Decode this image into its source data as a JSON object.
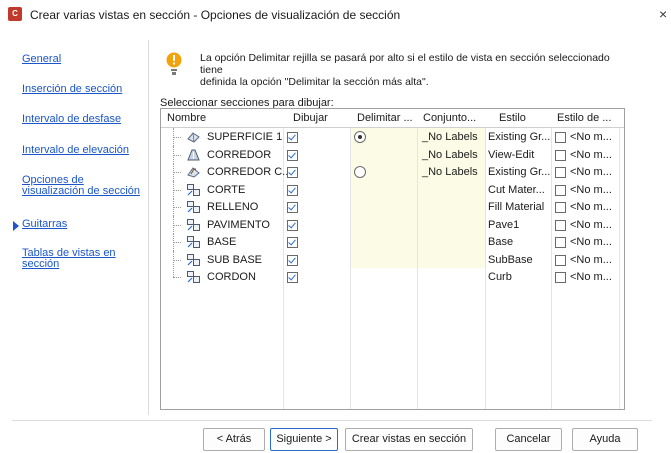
{
  "window": {
    "title": "Crear varias vistas en sección - Opciones de visualización de sección",
    "close_label": "×"
  },
  "nav": {
    "items": [
      {
        "label": "General"
      },
      {
        "label": "Inserción de sección"
      },
      {
        "label": "Intervalo de desfase"
      },
      {
        "label": "Intervalo de elevación"
      },
      {
        "label": "Opciones de visualización de sección",
        "line1": "Opciones de",
        "line2": "visualización de sección",
        "active": true
      },
      {
        "label": "Guitarras"
      },
      {
        "label": "Tablas de vistas en sección",
        "line1": "Tablas de vistas en",
        "line2": "sección"
      }
    ]
  },
  "info": {
    "line1": "La opción Delimitar rejilla se pasará por alto si el estilo de vista en sección seleccionado tiene",
    "line2": "definida la opción \"Delimitar la sección más alta\"."
  },
  "grid": {
    "label": "Seleccionar secciones para dibujar:",
    "columns": [
      "Nombre",
      "Dibujar",
      "Delimitar ...",
      "Conjunto...",
      "Estilo",
      "Estilo de ..."
    ],
    "rows": [
      {
        "name": "SUPERFICIE 1",
        "icon": "surface-icon",
        "draw": true,
        "clip": "radio-on",
        "set": "_No Labels",
        "style": "Existing Gr...",
        "override": "<No m..."
      },
      {
        "name": "CORREDOR",
        "icon": "corridor-icon",
        "draw": true,
        "clip": "none",
        "set": "_No Labels",
        "style": "View-Edit",
        "override": "<No m..."
      },
      {
        "name": "CORREDOR C...",
        "icon": "corridor-surface-icon",
        "draw": true,
        "clip": "radio-off",
        "set": "_No Labels",
        "style": "Existing Gr...",
        "override": "<No m..."
      },
      {
        "name": "CORTE",
        "icon": "material-icon",
        "draw": true,
        "clip": "none",
        "set": "",
        "style": "Cut Mater...",
        "override": "<No m..."
      },
      {
        "name": "RELLENO",
        "icon": "material-icon",
        "draw": true,
        "clip": "none",
        "set": "",
        "style": "Fill Material",
        "override": "<No m..."
      },
      {
        "name": "PAVIMENTO",
        "icon": "material-icon",
        "draw": true,
        "clip": "none",
        "set": "",
        "style": "Pave1",
        "override": "<No m..."
      },
      {
        "name": "BASE",
        "icon": "material-icon",
        "draw": true,
        "clip": "none",
        "set": "",
        "style": "Base",
        "override": "<No m..."
      },
      {
        "name": "SUB BASE",
        "icon": "material-icon",
        "draw": true,
        "clip": "none",
        "set": "",
        "style": "SubBase",
        "override": "<No m..."
      },
      {
        "name": "CORDON",
        "icon": "material-icon",
        "draw": true,
        "clip": "none",
        "set": "",
        "style": "Curb",
        "override": "<No m..."
      }
    ]
  },
  "buttons": {
    "back": "< Atrás",
    "next": "Siguiente >",
    "create": "Crear vistas en sección",
    "cancel": "Cancelar",
    "help": "Ayuda"
  },
  "colors": {
    "link": "#1a56c8",
    "accent": "#2a6bd0",
    "highlight": "#fcfce6",
    "warning": "#f0a30a"
  }
}
